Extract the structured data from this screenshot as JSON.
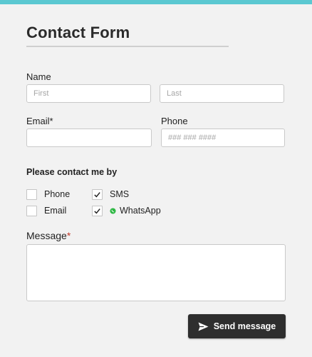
{
  "form": {
    "title": "Contact Form",
    "name_label": "Name",
    "first_placeholder": "First",
    "last_placeholder": "Last",
    "email_label": "Email",
    "email_required_mark": "*",
    "phone_label": "Phone",
    "phone_placeholder": "### ### ####",
    "contact_by_label": "Please contact me by",
    "options": {
      "phone": {
        "label": "Phone",
        "checked": false
      },
      "sms": {
        "label": "SMS",
        "checked": true
      },
      "email": {
        "label": "Email",
        "checked": false
      },
      "whatsapp": {
        "label": "WhatsApp",
        "checked": true,
        "icon": "whatsapp-icon"
      }
    },
    "message_label": "Message",
    "message_required_mark": "*",
    "send_label": "Send message",
    "send_icon": "send-icon"
  },
  "colors": {
    "accent_bar": "#5bc8d1",
    "button_bg": "#2e2e2e",
    "required": "#c0392b",
    "whatsapp": "#2cb742"
  }
}
